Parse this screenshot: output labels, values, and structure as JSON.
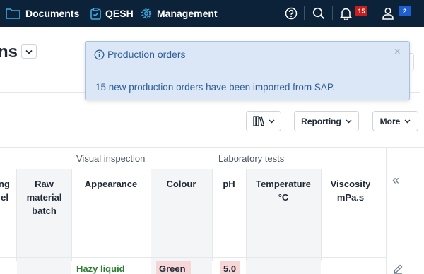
{
  "nav": {
    "documents": "Documents",
    "qesh": "QESH",
    "management": "Management",
    "notifications_count": "15",
    "user_count": "2"
  },
  "page": {
    "title": "ns"
  },
  "toast": {
    "title": "Production orders",
    "body": "15 new production orders have been imported from SAP.",
    "close": "×"
  },
  "toolbar": {
    "reporting": "Reporting",
    "more": "More"
  },
  "table": {
    "groups": {
      "visual": "Visual inspection",
      "lab": "Laboratory tests"
    },
    "columns": {
      "partial_1": "ng",
      "partial_2": "el",
      "raw_1": "Raw",
      "raw_2": "material",
      "raw_3": "batch",
      "appearance": "Appearance",
      "colour": "Colour",
      "ph": "pH",
      "temp_1": "Temperature",
      "temp_2": "°C",
      "visc_1": "Viscosity",
      "visc_2": "mPa.s"
    },
    "row": {
      "appearance": "Hazy liquid",
      "colour": "Green",
      "ph": "5.0"
    },
    "collapse": "«"
  },
  "colors": {
    "nav_bg": "#0b2239",
    "accent": "#2f5f98",
    "badge_red": "#c81e1e",
    "badge_blue": "#1d5fd1",
    "ok_green": "#2e7d32",
    "chip_red": "#f6d6d6"
  }
}
